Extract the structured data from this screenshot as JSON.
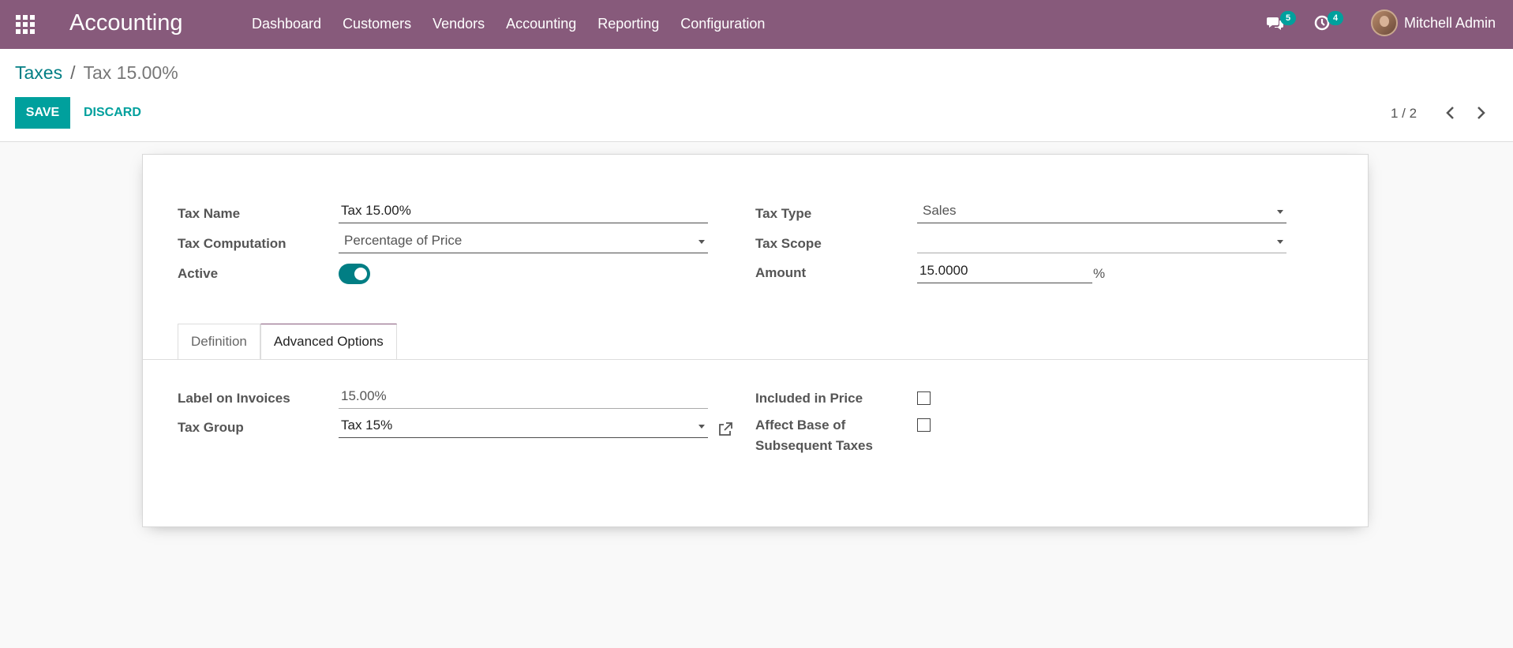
{
  "navbar": {
    "app_title": "Accounting",
    "menu": [
      "Dashboard",
      "Customers",
      "Vendors",
      "Accounting",
      "Reporting",
      "Configuration"
    ],
    "messages_badge": "5",
    "activities_badge": "4",
    "user_name": "Mitchell Admin"
  },
  "control_panel": {
    "breadcrumb_parent": "Taxes",
    "breadcrumb_separator": "/",
    "breadcrumb_current": "Tax 15.00%",
    "save_label": "SAVE",
    "discard_label": "DISCARD",
    "pager": "1 / 2"
  },
  "form": {
    "tax_name_label": "Tax Name",
    "tax_name_value": "Tax 15.00%",
    "tax_computation_label": "Tax Computation",
    "tax_computation_value": "Percentage of Price",
    "active_label": "Active",
    "active_value": true,
    "tax_type_label": "Tax Type",
    "tax_type_value": "Sales",
    "tax_scope_label": "Tax Scope",
    "tax_scope_value": "",
    "amount_label": "Amount",
    "amount_value": "15.0000",
    "amount_unit": "%"
  },
  "tabs": [
    {
      "label": "Definition",
      "active": false
    },
    {
      "label": "Advanced Options",
      "active": true
    }
  ],
  "advanced": {
    "label_on_invoices_label": "Label on Invoices",
    "label_on_invoices_value": "15.00%",
    "tax_group_label": "Tax Group",
    "tax_group_value": "Tax 15%",
    "included_in_price_label": "Included in Price",
    "included_in_price_value": false,
    "affect_base_label_line1": "Affect Base of",
    "affect_base_label_line2": "Subsequent Taxes",
    "affect_base_value": false
  },
  "colors": {
    "navbar": "#875a7b",
    "primary": "#00a09d",
    "link": "#017e84"
  }
}
